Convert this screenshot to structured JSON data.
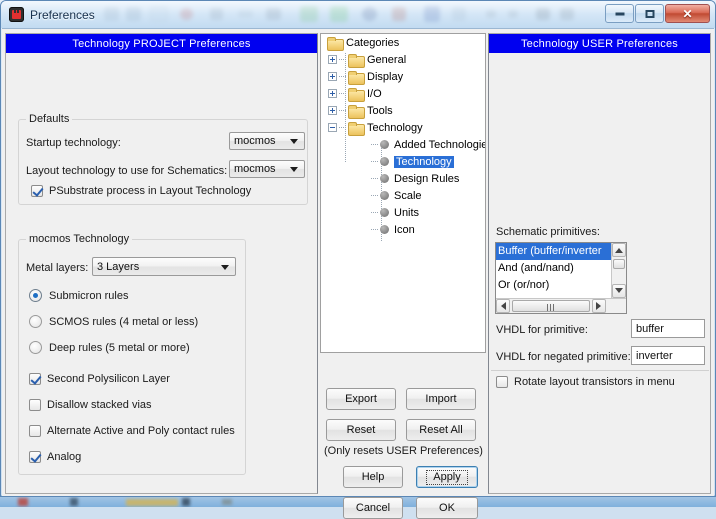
{
  "window": {
    "title": "Preferences",
    "app_icon": "electric-icon",
    "buttons": {
      "minimize": "minimize-icon",
      "maximize": "maximize-icon",
      "close": "close-icon"
    }
  },
  "project_panel": {
    "header": "Technology PROJECT Preferences",
    "defaults_group": {
      "title": "Defaults",
      "startup_label": "Startup technology:",
      "startup_value": "mocmos",
      "layout_label": "Layout technology to use for Schematics:",
      "layout_value": "mocmos",
      "psubstrate_label": "PSubstrate process in Layout Technology",
      "psubstrate_checked": true
    },
    "tech_group": {
      "title": "mocmos Technology",
      "metal_label": "Metal layers:",
      "metal_value": "3 Layers",
      "radios": [
        {
          "label": "Submicron rules",
          "selected": true
        },
        {
          "label": "SCMOS rules (4 metal or less)",
          "selected": false
        },
        {
          "label": "Deep rules (5 metal or more)",
          "selected": false
        }
      ],
      "checks": [
        {
          "label": "Second Polysilicon Layer",
          "checked": true
        },
        {
          "label": "Disallow stacked vias",
          "checked": false
        },
        {
          "label": "Alternate Active and Poly contact rules",
          "checked": false
        },
        {
          "label": "Analog",
          "checked": true
        }
      ]
    }
  },
  "tree": {
    "root": "Categories",
    "folders": [
      {
        "label": "General",
        "expanded": false
      },
      {
        "label": "Display",
        "expanded": false
      },
      {
        "label": "I/O",
        "expanded": false
      },
      {
        "label": "Tools",
        "expanded": false
      },
      {
        "label": "Technology",
        "expanded": true
      }
    ],
    "leaves": [
      {
        "label": "Added Technologies",
        "selected": false
      },
      {
        "label": "Technology",
        "selected": true
      },
      {
        "label": "Design Rules",
        "selected": false
      },
      {
        "label": "Scale",
        "selected": false
      },
      {
        "label": "Units",
        "selected": false
      },
      {
        "label": "Icon",
        "selected": false
      }
    ]
  },
  "actions": {
    "export": "Export",
    "import": "Import",
    "reset": "Reset",
    "reset_all": "Reset All",
    "reset_note": "(Only resets USER Preferences)",
    "help": "Help",
    "apply": "Apply",
    "cancel": "Cancel",
    "ok": "OK"
  },
  "user_panel": {
    "header": "Technology USER Preferences",
    "primitives_label": "Schematic primitives:",
    "primitives": [
      {
        "label": "Buffer  (buffer/inverter",
        "selected": true
      },
      {
        "label": "And  (and/nand)",
        "selected": false
      },
      {
        "label": "Or  (or/nor)",
        "selected": false
      }
    ],
    "vhdl_label": "VHDL for primitive:",
    "vhdl_value": "buffer",
    "vhdl_neg_label": "VHDL for negated primitive:",
    "vhdl_neg_value": "inverter",
    "rotate_label": "Rotate layout transistors in menu",
    "rotate_checked": false
  },
  "colors": {
    "header_blue": "#0000f0",
    "selection_blue": "#2a6fd6",
    "window_face": "#f0f0f0"
  }
}
